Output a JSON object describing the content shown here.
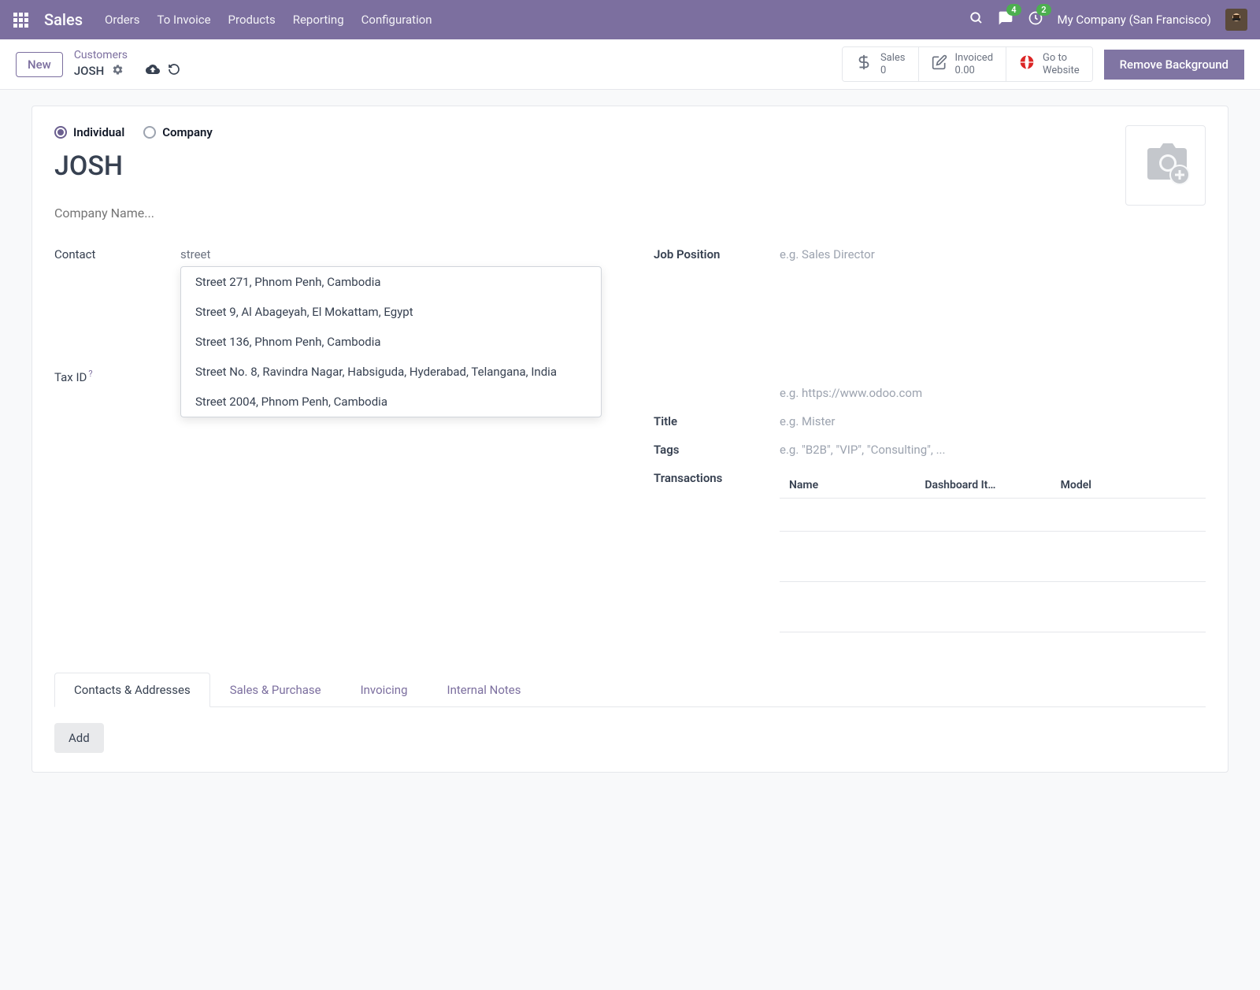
{
  "navbar": {
    "brand": "Sales",
    "menu": [
      "Orders",
      "To Invoice",
      "Products",
      "Reporting",
      "Configuration"
    ],
    "chat_badge": "4",
    "activity_badge": "2",
    "company": "My Company (San Francisco)"
  },
  "actionbar": {
    "new": "New",
    "breadcrumb_top": "Customers",
    "breadcrumb_current": "JOSH",
    "stats": {
      "sales_label": "Sales",
      "sales_value": "0",
      "invoiced_label": "Invoiced",
      "invoiced_value": "0.00",
      "goto_label": "Go to",
      "goto_value": "Website"
    },
    "remove_bg": "Remove Background"
  },
  "form": {
    "type_individual": "Individual",
    "type_company": "Company",
    "name": "JOSH",
    "company_placeholder": "Company Name...",
    "fields": {
      "contact_label": "Contact",
      "street_value": "street",
      "tax_id_label": "Tax ID",
      "job_position_label": "Job Position",
      "job_position_placeholder": "e.g. Sales Director",
      "website_placeholder": "e.g. https://www.odoo.com",
      "title_label": "Title",
      "title_placeholder": "e.g. Mister",
      "tags_label": "Tags",
      "tags_placeholder": "e.g. \"B2B\", \"VIP\", \"Consulting\", ...",
      "transactions_label": "Transactions"
    },
    "dropdown": [
      "Street 271, Phnom Penh, Cambodia",
      "Street 9, Al Abageyah, El Mokattam, Egypt",
      "Street 136, Phnom Penh, Cambodia",
      "Street No. 8, Ravindra Nagar, Habsiguda, Hyderabad, Telangana, India",
      "Street 2004, Phnom Penh, Cambodia"
    ],
    "trans_headers": {
      "name": "Name",
      "dashboard": "Dashboard It…",
      "model": "Model"
    },
    "tabs": [
      "Contacts & Addresses",
      "Sales & Purchase",
      "Invoicing",
      "Internal Notes"
    ],
    "add_btn": "Add"
  }
}
